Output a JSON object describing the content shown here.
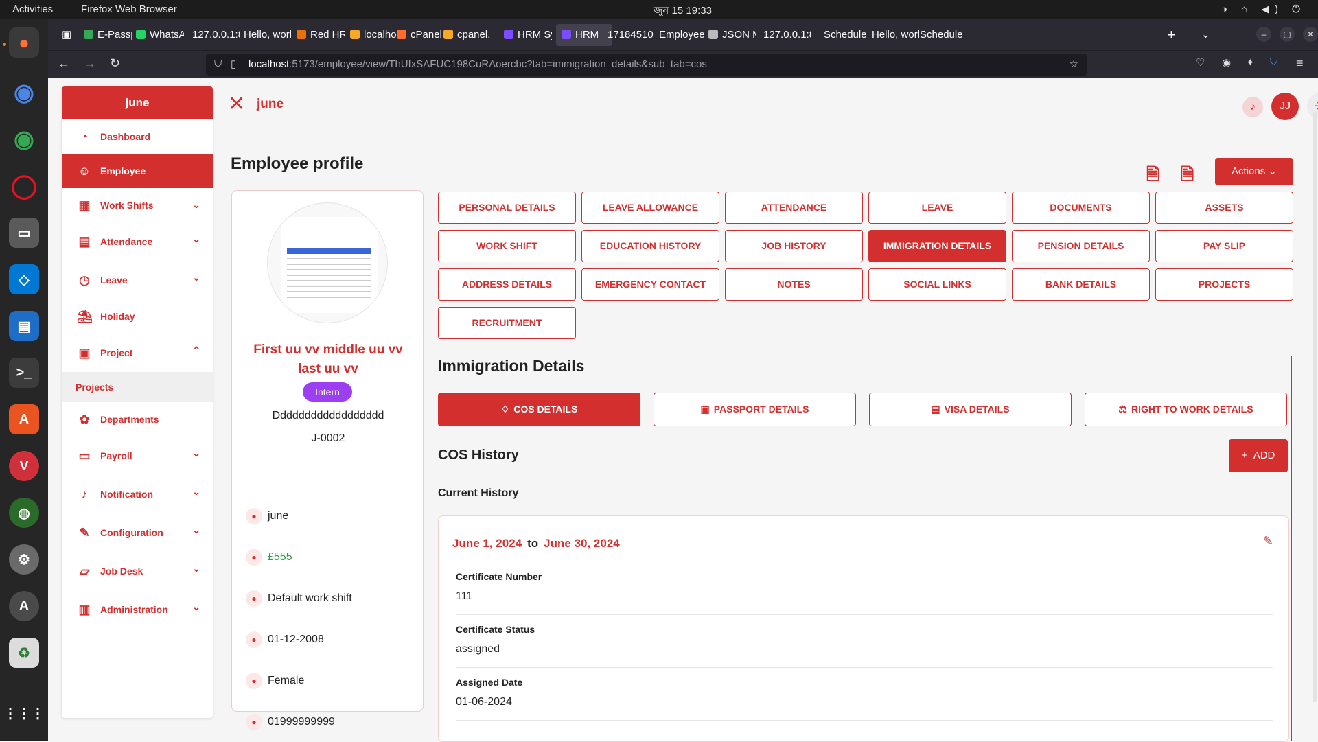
{
  "system": {
    "activities": "Activities",
    "browser_name": "Firefox Web Browser",
    "clock": "জুন 15  19:33"
  },
  "browser": {
    "tabs": [
      {
        "label": "E-Passp",
        "color": "#34a853"
      },
      {
        "label": "WhatsA",
        "color": "#25d366"
      },
      {
        "label": "127.0.0.1:8",
        "color": ""
      },
      {
        "label": "Hello, worl",
        "color": ""
      },
      {
        "label": "Red HR",
        "color": "#e8710a"
      },
      {
        "label": "localho",
        "color": "#f9a825"
      },
      {
        "label": "cPanel",
        "color": "#ff6c2c"
      },
      {
        "label": "cpanel.",
        "color": "#f9a825"
      },
      {
        "label": "HRM Sy",
        "color": "#7c4dff"
      },
      {
        "label": "HRM",
        "color": "#7c4dff"
      },
      {
        "label": "17184510",
        "color": ""
      },
      {
        "label": "Employee",
        "color": ""
      },
      {
        "label": "JSON M",
        "color": "#bbbbbb"
      },
      {
        "label": "127.0.0.1:8",
        "color": ""
      },
      {
        "label": "Schedule",
        "color": ""
      },
      {
        "label": "Hello, worl",
        "color": ""
      },
      {
        "label": "Schedule",
        "color": ""
      }
    ],
    "url_host": "localhost",
    "url_rest": ":5173/employee/view/ThUfxSAFUC198CuRAoercbc?tab=immigration_details&sub_tab=cos"
  },
  "sidebar": {
    "header": "june",
    "items": [
      {
        "label": "Dashboard",
        "icon": "pie-chart-icon",
        "glyph": "◔",
        "chevron": ""
      },
      {
        "label": "Employee",
        "icon": "users-icon",
        "glyph": "☺",
        "chevron": ""
      },
      {
        "label": "Work Shifts",
        "icon": "calendar-clock-icon",
        "glyph": "▦",
        "chevron": "⌄"
      },
      {
        "label": "Attendance",
        "icon": "calendar-icon",
        "glyph": "▤",
        "chevron": "⌄"
      },
      {
        "label": "Leave",
        "icon": "clock-icon",
        "glyph": "◷",
        "chevron": "⌄"
      },
      {
        "label": "Holiday",
        "icon": "beach-icon",
        "glyph": "⛱",
        "chevron": ""
      },
      {
        "label": "Project",
        "icon": "clipboard-icon",
        "glyph": "▣",
        "chevron": "⌃"
      }
    ],
    "sub_item": "Projects",
    "items2": [
      {
        "label": "Departments",
        "icon": "network-icon",
        "glyph": "✿",
        "chevron": ""
      },
      {
        "label": "Payroll",
        "icon": "card-icon",
        "glyph": "▭",
        "chevron": "⌄"
      },
      {
        "label": "Notification",
        "icon": "bell-icon",
        "glyph": "♪",
        "chevron": "⌄"
      },
      {
        "label": "Configuration",
        "icon": "wrench-icon",
        "glyph": "✎",
        "chevron": "⌄"
      },
      {
        "label": "Job Desk",
        "icon": "inbox-icon",
        "glyph": "▱",
        "chevron": "⌄"
      },
      {
        "label": "Administration",
        "icon": "briefcase-icon",
        "glyph": "▥",
        "chevron": "⌄"
      }
    ]
  },
  "header": {
    "name": "june",
    "avatar_initials": "JJ"
  },
  "page": {
    "title": "Employee profile",
    "pdf_label": "PDF",
    "csv_label": "CSV",
    "actions_label": "Actions"
  },
  "profile": {
    "full_name": "First uu vv middle uu vv last uu vv",
    "role_badge": "Intern",
    "description": "Dddddddddddddddddd",
    "employee_id": "J-0002",
    "details": [
      {
        "value": "june",
        "icon": "clipboard-icon",
        "color": "#222"
      },
      {
        "value": "£555",
        "icon": "wallet-icon",
        "color": "#2e9e4a"
      },
      {
        "value": "Default work shift",
        "icon": "clock-icon",
        "color": "#222"
      },
      {
        "value": "01-12-2008",
        "icon": "calendar-icon",
        "color": "#222"
      },
      {
        "value": "Female",
        "icon": "gender-icon",
        "color": "#222"
      },
      {
        "value": "01999999999",
        "icon": "phone-icon",
        "color": "#222"
      }
    ]
  },
  "profile_tabs": [
    "PERSONAL DETAILS",
    "LEAVE ALLOWANCE",
    "ATTENDANCE",
    "LEAVE",
    "DOCUMENTS",
    "ASSETS",
    "WORK SHIFT",
    "EDUCATION HISTORY",
    "JOB HISTORY",
    "IMMIGRATION DETAILS",
    "PENSION DETAILS",
    "PAY SLIP",
    "ADDRESS DETAILS",
    "EMERGENCY CONTACT",
    "NOTES",
    "SOCIAL LINKS",
    "BANK DETAILS",
    "PROJECTS",
    "RECRUITMENT"
  ],
  "selected_tab": "IMMIGRATION DETAILS",
  "immigration": {
    "title": "Immigration Details",
    "subtabs": [
      {
        "label": "COS DETAILS",
        "icon": "badge-icon",
        "glyph": "♢"
      },
      {
        "label": "PASSPORT DETAILS",
        "icon": "passport-icon",
        "glyph": "▣"
      },
      {
        "label": "VISA DETAILS",
        "icon": "file-icon",
        "glyph": "▤"
      },
      {
        "label": "RIGHT TO WORK DETAILS",
        "icon": "scale-icon",
        "glyph": "⚖"
      }
    ],
    "selected_subtab": "COS DETAILS",
    "cos_title": "COS History",
    "add_label": "ADD",
    "current_label": "Current History",
    "start_date": "June 1, 2024",
    "to": "to",
    "end_date": "June 30, 2024",
    "fields": [
      {
        "label": "Certificate Number",
        "value": "111"
      },
      {
        "label": "Certificate Status",
        "value": "assigned"
      },
      {
        "label": "Assigned Date",
        "value": "01-06-2024"
      }
    ]
  },
  "colors": {
    "accent": "#d32f2f",
    "badge": "#9c3ff0",
    "salary": "#2e9e4a"
  }
}
